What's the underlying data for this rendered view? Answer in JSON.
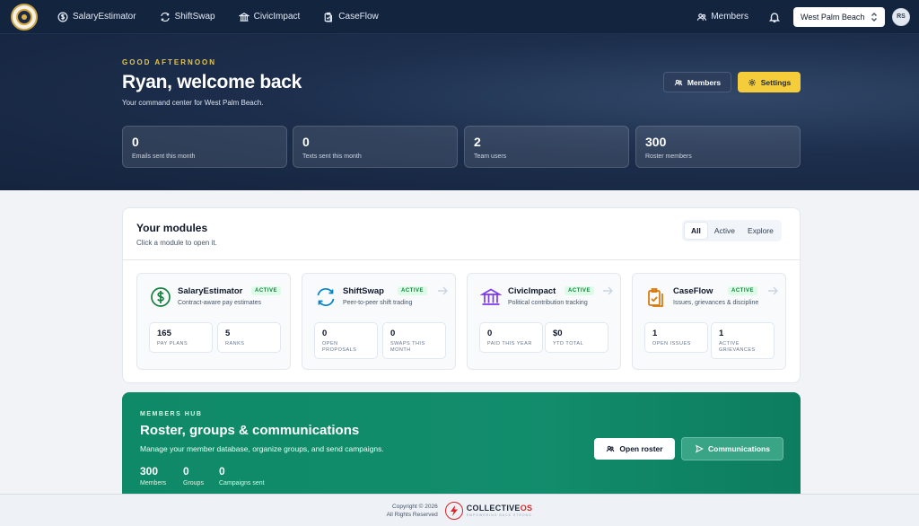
{
  "nav": {
    "items": [
      {
        "label": "SalaryEstimator",
        "icon": "dollar-circle-icon"
      },
      {
        "label": "ShiftSwap",
        "icon": "refresh-icon"
      },
      {
        "label": "CivicImpact",
        "icon": "building-icon"
      },
      {
        "label": "CaseFlow",
        "icon": "clipboard-icon"
      }
    ],
    "members_label": "Members",
    "location": "West Palm Beach",
    "avatar_initials": "RS"
  },
  "hero": {
    "greeting": "GOOD AFTERNOON",
    "title": "Ryan, welcome back",
    "subtitle": "Your command center for West Palm Beach.",
    "members_button": "Members",
    "settings_button": "Settings",
    "stats": [
      {
        "value": "0",
        "label": "Emails sent this month"
      },
      {
        "value": "0",
        "label": "Texts sent this month"
      },
      {
        "value": "2",
        "label": "Team users"
      },
      {
        "value": "300",
        "label": "Roster members"
      }
    ]
  },
  "modules": {
    "title": "Your modules",
    "subtitle": "Click a module to open it.",
    "filters": [
      "All",
      "Active",
      "Explore"
    ],
    "active_filter": "All",
    "cards": [
      {
        "name": "SalaryEstimator",
        "badge": "ACTIVE",
        "desc": "Contract-aware pay estimates",
        "icon": "dollar-circle-icon",
        "stats": [
          {
            "value": "165",
            "label": "PAY PLANS"
          },
          {
            "value": "5",
            "label": "RANKS"
          }
        ]
      },
      {
        "name": "ShiftSwap",
        "badge": "ACTIVE",
        "desc": "Peer-to-peer shift trading",
        "icon": "refresh-icon",
        "stats": [
          {
            "value": "0",
            "label": "OPEN PROPOSALS"
          },
          {
            "value": "0",
            "label": "SWAPS THIS MONTH"
          }
        ]
      },
      {
        "name": "CivicImpact",
        "badge": "ACTIVE",
        "desc": "Political contribution tracking",
        "icon": "building-icon",
        "stats": [
          {
            "value": "0",
            "label": "PAID THIS YEAR"
          },
          {
            "value": "$0",
            "label": "YTD TOTAL"
          }
        ]
      },
      {
        "name": "CaseFlow",
        "badge": "ACTIVE",
        "desc": "Issues, grievances & discipline",
        "icon": "clipboard-icon",
        "stats": [
          {
            "value": "1",
            "label": "OPEN ISSUES"
          },
          {
            "value": "1",
            "label": "ACTIVE GRIEVANCES"
          }
        ]
      }
    ]
  },
  "hub": {
    "eyebrow": "MEMBERS HUB",
    "title": "Roster, groups & communications",
    "subtitle": "Manage your member database, organize groups, and send campaigns.",
    "stats": [
      {
        "value": "300",
        "label": "Members"
      },
      {
        "value": "0",
        "label": "Groups"
      },
      {
        "value": "0",
        "label": "Campaigns sent"
      }
    ],
    "roster_button": "Open roster",
    "comms_button": "Communications"
  },
  "footer": {
    "copyright_line1": "Copyright © 2026",
    "copyright_line2": "All Rights Reserved",
    "brand_main": "COLLECTIVE",
    "brand_suffix": "OS",
    "brand_tagline": "EMPOWERING BACK STRONG"
  },
  "colors": {
    "nav_bg": "#13243f",
    "accent_yellow": "#f5cd3a",
    "hub_green": "#0f8a68",
    "badge_green": "#15803d",
    "brand_red": "#dc2626"
  }
}
